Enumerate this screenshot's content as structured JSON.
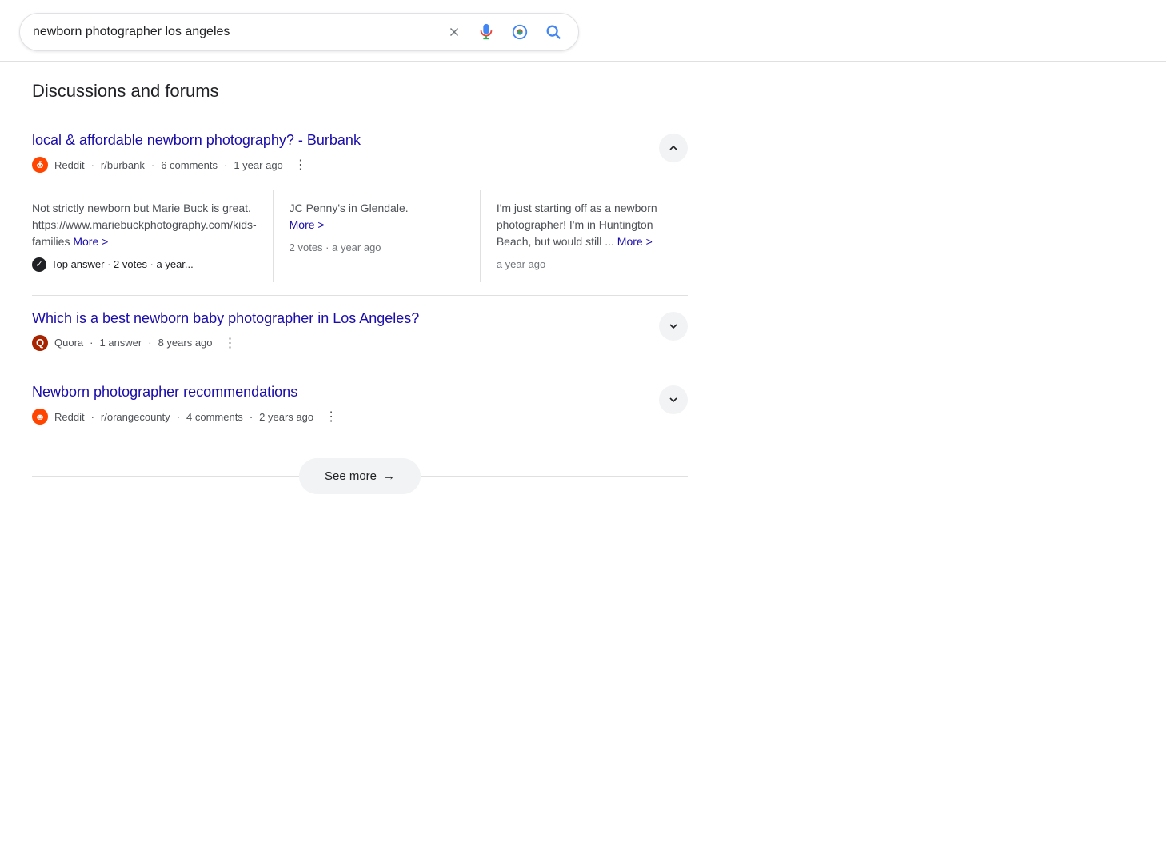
{
  "search": {
    "query": "newborn photographer los angeles",
    "placeholder": "newborn photographer los angeles"
  },
  "section_title": "Discussions and forums",
  "discussions": [
    {
      "id": "discussion-1",
      "title": "local & affordable newborn photography? - Burbank",
      "url": "#",
      "source_name": "Reddit",
      "source_type": "reddit",
      "subreddit": "r/burbank",
      "comments": "6 comments",
      "time_ago": "1 year ago",
      "expanded": true,
      "columns": [
        {
          "text": "Not strictly newborn but Marie Buck is great. https://www.mariebuckphotography.com/kids-families",
          "more_label": "More >",
          "has_more": true,
          "top_answer": true,
          "top_answer_label": "Top answer",
          "col_meta": "2 votes · a year..."
        },
        {
          "text": "JC Penny's in Glendale.",
          "more_label": "More >",
          "has_more": true,
          "col_meta": "2 votes · a year ago"
        },
        {
          "text": "I'm just starting off as a newborn photographer! I'm in Huntington Beach, but would still ...",
          "more_label": "More >",
          "has_more": true,
          "col_meta": "a year ago"
        }
      ]
    },
    {
      "id": "discussion-2",
      "title": "Which is a best newborn baby photographer in Los Angeles?",
      "url": "#",
      "source_name": "Quora",
      "source_type": "quora",
      "answers": "1 answer",
      "time_ago": "8 years ago",
      "expanded": false,
      "columns": []
    },
    {
      "id": "discussion-3",
      "title": "Newborn photographer recommendations",
      "url": "#",
      "source_name": "Reddit",
      "source_type": "reddit",
      "subreddit": "r/orangecounty",
      "comments": "4 comments",
      "time_ago": "2 years ago",
      "expanded": false,
      "columns": []
    }
  ],
  "see_more": {
    "label": "See more",
    "arrow": "→"
  }
}
